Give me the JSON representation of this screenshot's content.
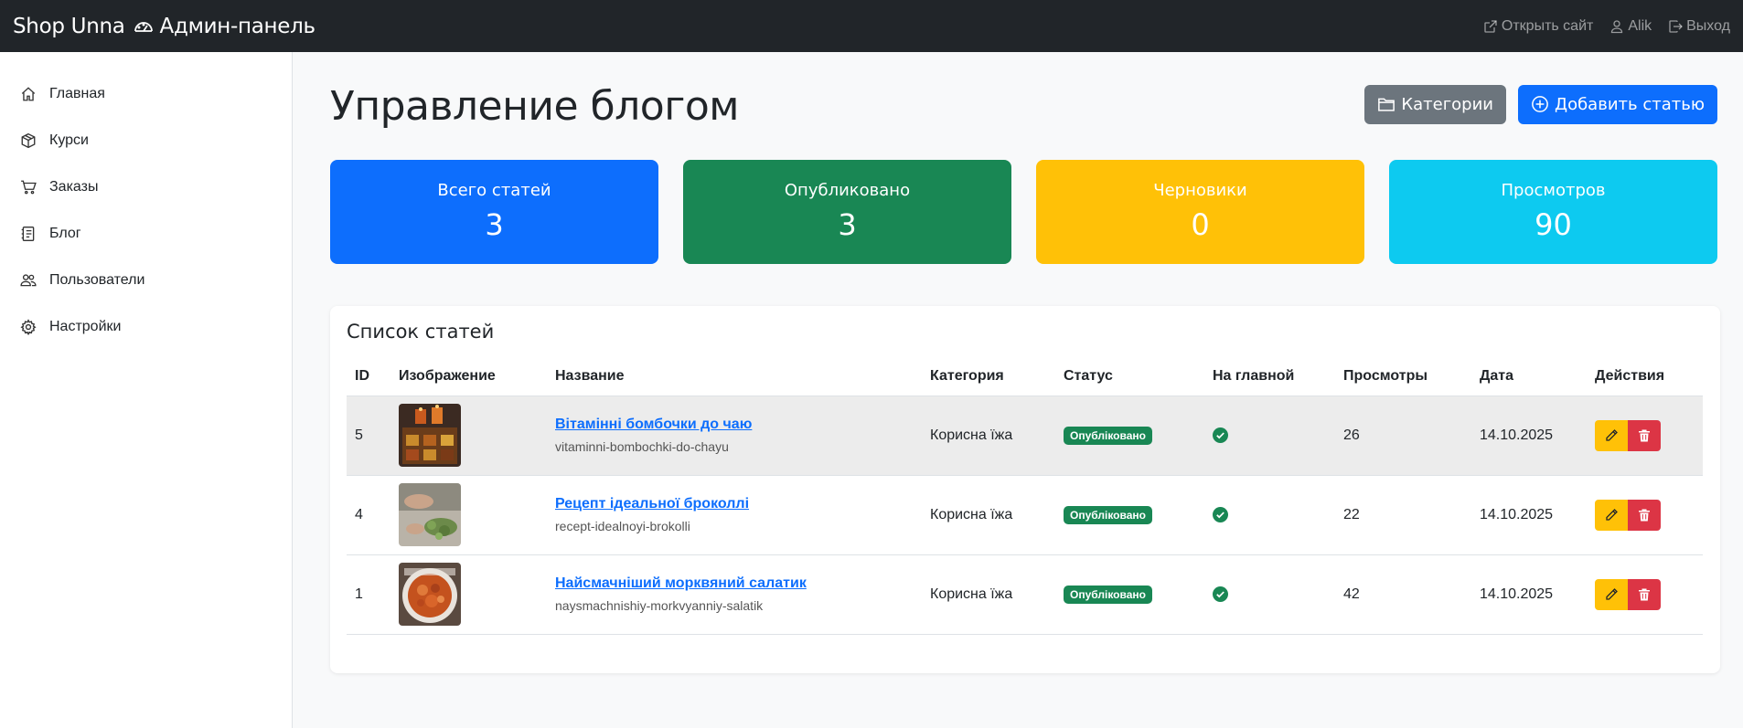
{
  "navbar": {
    "brand_left": "Shop Unna",
    "brand_right": "Админ-панель",
    "open_site": "Открыть сайт",
    "user": "Alik",
    "logout": "Выход"
  },
  "sidebar": {
    "items": [
      {
        "label": "Главная",
        "icon": "home-icon"
      },
      {
        "label": "Курси",
        "icon": "box-icon"
      },
      {
        "label": "Заказы",
        "icon": "cart-icon"
      },
      {
        "label": "Блог",
        "icon": "journal-icon"
      },
      {
        "label": "Пользователи",
        "icon": "people-icon"
      },
      {
        "label": "Настройки",
        "icon": "gear-icon"
      }
    ]
  },
  "page": {
    "title": "Управление блогом",
    "categories_button": "Категории",
    "add_button": "Добавить статью"
  },
  "stats": [
    {
      "label": "Всего статей",
      "value": "3",
      "color": "#0d6efd"
    },
    {
      "label": "Опубликовано",
      "value": "3",
      "color": "#198754"
    },
    {
      "label": "Черновики",
      "value": "0",
      "color": "#ffc107"
    },
    {
      "label": "Просмотров",
      "value": "90",
      "color": "#0dcaf0"
    }
  ],
  "table": {
    "title": "Список статей",
    "headers": [
      "ID",
      "Изображение",
      "Название",
      "Категория",
      "Статус",
      "На главной",
      "Просмотры",
      "Дата",
      "Действия"
    ],
    "rows": [
      {
        "id": "5",
        "title": "Вітамінні бомбочки до чаю",
        "slug": "vitaminni-bombochki-do-chayu",
        "category": "Корисна їжа",
        "status": "Опубліковано",
        "views": "26",
        "date": "14.10.2025"
      },
      {
        "id": "4",
        "title": "Рецепт ідеальної броколлі",
        "slug": "recept-idealnoyi-brokolli",
        "category": "Корисна їжа",
        "status": "Опубліковано",
        "views": "22",
        "date": "14.10.2025"
      },
      {
        "id": "1",
        "title": "Найсмачніший морквяний салатик",
        "slug": "naysmachnishiy-morkvyanniy-salatik",
        "category": "Корисна їжа",
        "status": "Опубліковано",
        "views": "42",
        "date": "14.10.2025"
      }
    ]
  }
}
